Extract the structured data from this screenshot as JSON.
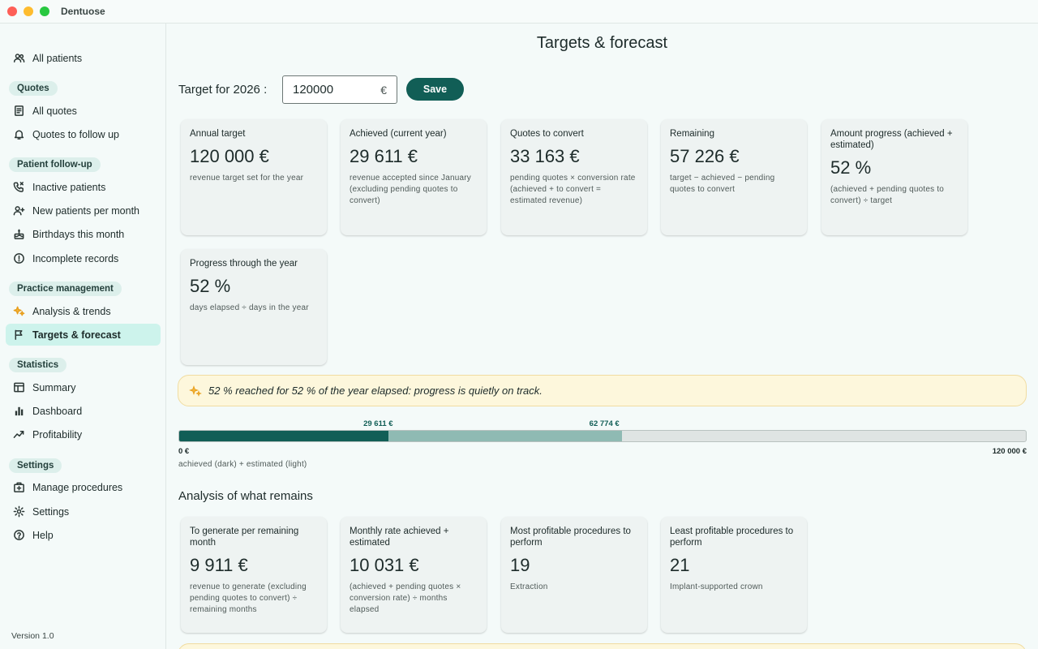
{
  "window": {
    "app_name": "Dentuose"
  },
  "sidebar": {
    "all_patients": "All patients",
    "sections": {
      "quotes": "Quotes",
      "followup": "Patient follow-up",
      "practice": "Practice management",
      "statistics": "Statistics",
      "settings": "Settings"
    },
    "items": {
      "all_quotes": "All quotes",
      "quotes_follow": "Quotes to follow up",
      "inactive": "Inactive patients",
      "new_patients": "New patients per month",
      "birthdays": "Birthdays this month",
      "incomplete": "Incomplete records",
      "analysis": "Analysis & trends",
      "targets": "Targets & forecast",
      "summary": "Summary",
      "dashboard": "Dashboard",
      "profitability": "Profitability",
      "manage_procedures": "Manage procedures",
      "settings": "Settings",
      "help": "Help"
    },
    "version": "Version 1.0"
  },
  "main": {
    "title": "Targets & forecast",
    "target_label": "Target for 2026 :",
    "target_value": "120000",
    "currency_symbol": "€",
    "save_label": "Save",
    "cards": [
      {
        "title": "Annual target",
        "value": "120 000 €",
        "desc": "revenue target set for the year"
      },
      {
        "title": "Achieved (current year)",
        "value": "29 611 €",
        "desc": "revenue accepted since January (excluding pending quotes to convert)"
      },
      {
        "title": "Quotes to convert",
        "value": "33 163 €",
        "desc": "pending quotes × conversion rate (achieved + to convert = estimated revenue)"
      },
      {
        "title": "Remaining",
        "value": "57 226 €",
        "desc": "target − achieved − pending quotes to convert"
      },
      {
        "title": "Amount progress (achieved + estimated)",
        "value": "52 %",
        "desc": "(achieved + pending quotes to convert) ÷ target"
      },
      {
        "title": "Progress through the year",
        "value": "52 %",
        "desc": "days elapsed ÷ days in the year"
      }
    ],
    "banner_text": "52 % reached for 52 % of the year elapsed: progress is quietly on track.",
    "progress": {
      "achieved_label": "29 611 €",
      "estimated_label": "62 774 €",
      "min_label": "0 €",
      "max_label": "120 000 €",
      "legend": "achieved (dark) + estimated (light)",
      "achieved_value": 29611,
      "estimated_value": 62774,
      "max_value": 120000
    },
    "analysis_title": "Analysis of what remains",
    "analysis_cards": [
      {
        "title": "To generate per remaining month",
        "value": "9 911 €",
        "desc": "revenue to generate (excluding pending quotes to convert) ÷ remaining months"
      },
      {
        "title": "Monthly rate achieved + estimated",
        "value": "10 031 €",
        "desc": "(achieved + pending quotes × conversion rate) ÷ months elapsed"
      },
      {
        "title": "Most profitable procedures to perform",
        "value": "19",
        "desc": "Extraction"
      },
      {
        "title": "Least profitable procedures to perform",
        "value": "21",
        "desc": "Implant-supported crown"
      }
    ]
  },
  "colors": {
    "accent": "#115e56",
    "estimated": "#8fbab3",
    "active_nav": "#cdf3ec",
    "banner_bg": "#fdf7dc"
  }
}
